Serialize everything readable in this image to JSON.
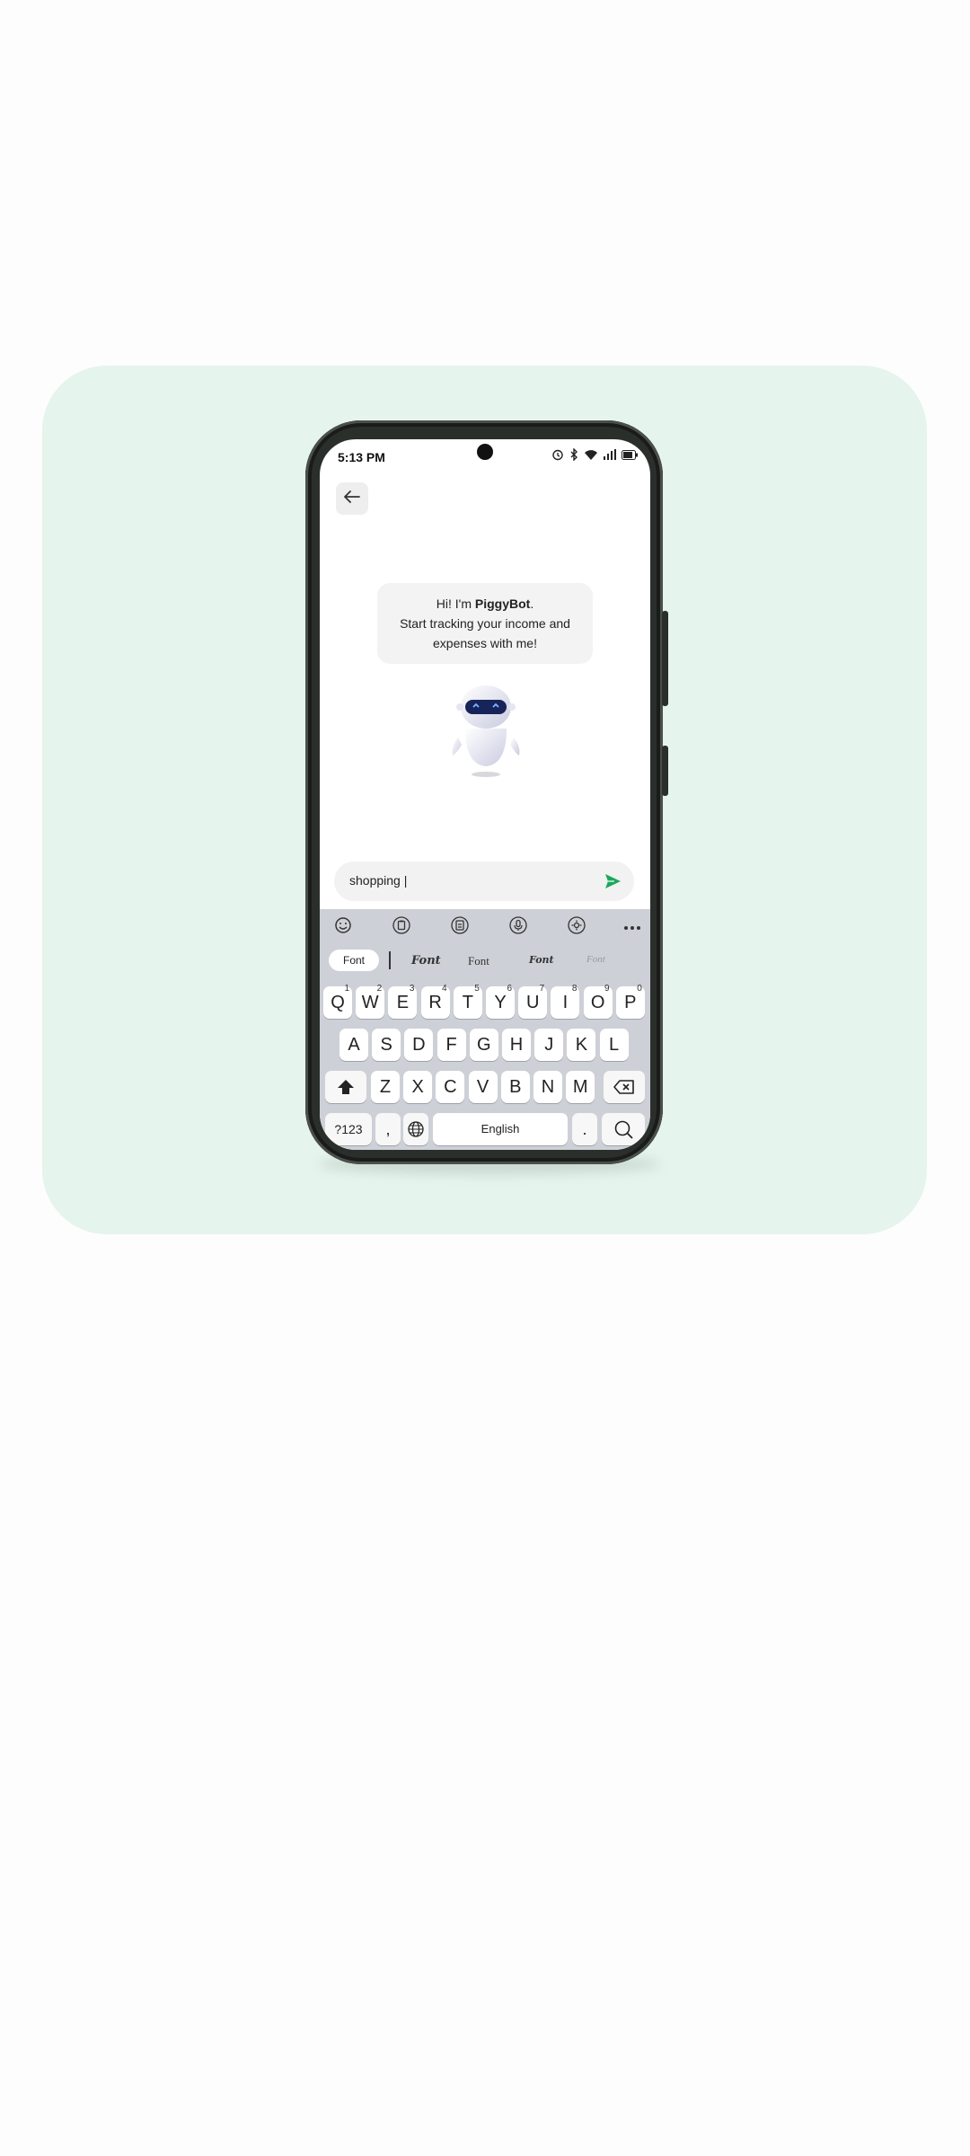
{
  "status_bar": {
    "time": "5:13 PM"
  },
  "chat": {
    "greeting_prefix": "Hi! I'm ",
    "bot_name": "PiggyBot",
    "greeting_suffix": ".",
    "line2": "Start tracking your income and",
    "line3": "expenses with me!"
  },
  "input": {
    "value": "shopping |"
  },
  "keyboard": {
    "font_pill": "Font",
    "font_options": [
      "Font",
      "Font",
      "Font",
      "Font"
    ],
    "row1": [
      {
        "key": "Q",
        "num": "1"
      },
      {
        "key": "W",
        "num": "2"
      },
      {
        "key": "E",
        "num": "3"
      },
      {
        "key": "R",
        "num": "4"
      },
      {
        "key": "T",
        "num": "5"
      },
      {
        "key": "Y",
        "num": "6"
      },
      {
        "key": "U",
        "num": "7"
      },
      {
        "key": "I",
        "num": "8"
      },
      {
        "key": "O",
        "num": "9"
      },
      {
        "key": "P",
        "num": "0"
      }
    ],
    "row2": [
      "A",
      "S",
      "D",
      "F",
      "G",
      "H",
      "J",
      "K",
      "L"
    ],
    "row3": [
      "Z",
      "X",
      "C",
      "V",
      "B",
      "N",
      "M"
    ],
    "symbols_key": "?123",
    "comma_key": ",",
    "space_key": "English",
    "period_key": "."
  },
  "colors": {
    "accent": "#1aa85b",
    "card_bg": "#e5f4ec"
  },
  "icons": [
    "back-arrow-icon",
    "alarm-icon",
    "bluetooth-icon",
    "wifi-icon",
    "signal-icon",
    "battery-icon",
    "send-icon",
    "emoji-icon",
    "clipboard-icon",
    "sticker-icon",
    "mic-icon",
    "settings-icon",
    "more-icon",
    "shift-icon",
    "backspace-icon",
    "globe-icon",
    "search-icon"
  ]
}
